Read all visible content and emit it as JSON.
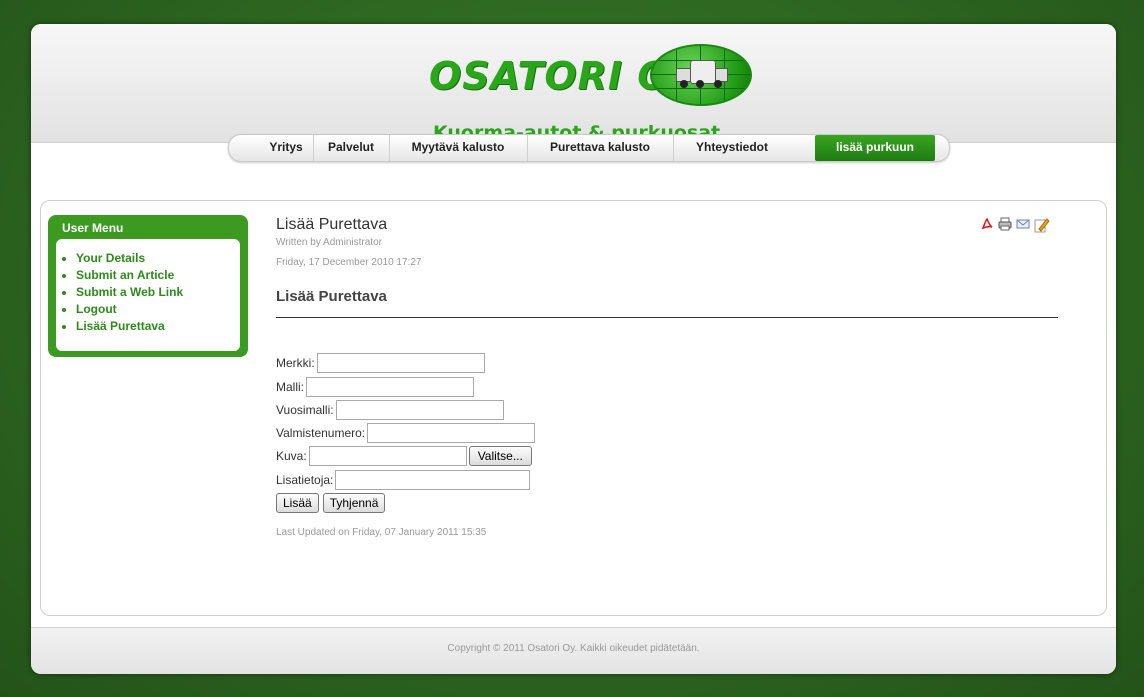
{
  "logo": {
    "title": "OSATORI OY",
    "subtitle": "Kuorma-autot & purkuosat"
  },
  "nav": {
    "items": [
      {
        "label": "Yritys"
      },
      {
        "label": "Palvelut"
      },
      {
        "label": "Myytävä kalusto"
      },
      {
        "label": "Purettava kalusto"
      },
      {
        "label": "Yhteystiedot"
      },
      {
        "label": "lisää purkuun"
      }
    ],
    "active_index": 5
  },
  "user_menu": {
    "title": "User Menu",
    "items": [
      {
        "label": "Your Details"
      },
      {
        "label": "Submit an Article"
      },
      {
        "label": "Submit a Web Link"
      },
      {
        "label": "Logout"
      },
      {
        "label": "Lisää Purettava"
      }
    ]
  },
  "article": {
    "title": "Lisää Purettava",
    "written_by": "Written by Administrator",
    "date": "Friday, 17 December 2010 17:27",
    "heading": "Lisää Purettava",
    "last_updated": "Last Updated on Friday, 07 January 2011 15:35",
    "icons": [
      "pdf-icon",
      "print-icon",
      "email-icon",
      "edit-icon"
    ]
  },
  "form": {
    "fields": [
      {
        "label": "Merkki:",
        "value": ""
      },
      {
        "label": "Malli:",
        "value": ""
      },
      {
        "label": "Vuosimalli:",
        "value": ""
      },
      {
        "label": "Valmistenumero:",
        "value": ""
      },
      {
        "label": "Kuva:",
        "value": ""
      },
      {
        "label": "Lisatietoja:",
        "value": ""
      }
    ],
    "browse_label": "Valitse...",
    "submit_label": "Lisää",
    "reset_label": "Tyhjennä"
  },
  "footer": {
    "copyright": "Copyright © 2011 Osatori Oy. Kaikki oikeudet pidätetään."
  },
  "colors": {
    "brand_green": "#2aa61a",
    "menu_green": "#3d9a20",
    "background": "#2f6a1f"
  }
}
